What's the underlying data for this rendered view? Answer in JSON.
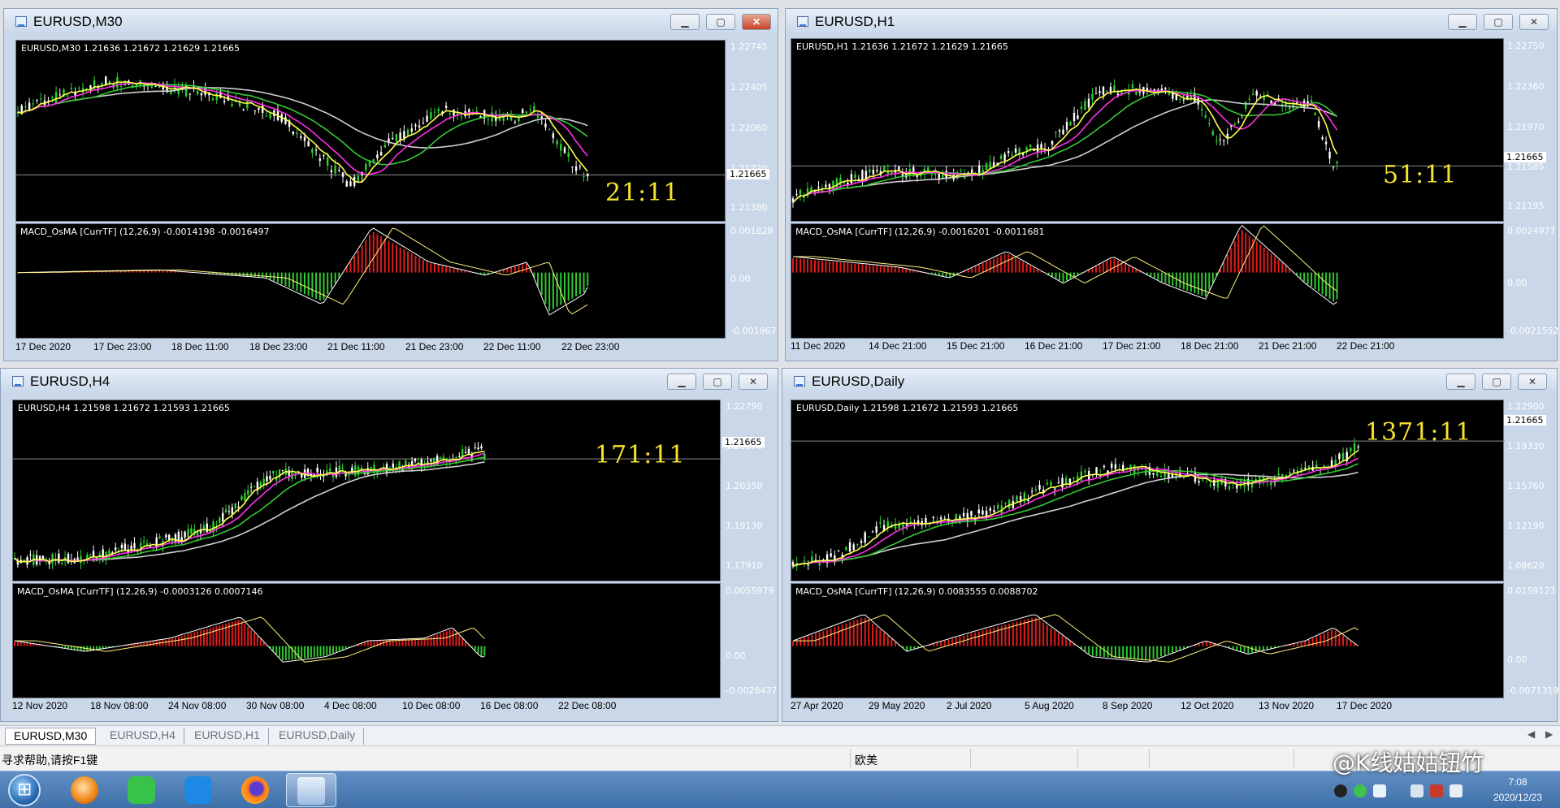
{
  "colors": {
    "bull_candle": "#2fd12f",
    "bear_candle": "#ffffff",
    "ma_yellow": "#ffff4d",
    "ma_magenta": "#ff2fe6",
    "ma_green": "#36c936",
    "ma_gray": "#cfcfcf",
    "macd_pos": "#e11c1c",
    "macd_neg": "#32c832",
    "timer": "#f5e22c"
  },
  "charts": [
    {
      "window_title": "EURUSD,M30",
      "main_header": "EURUSD,M30  1.21636 1.21672 1.21629 1.21665",
      "price_ticks": [
        "1.22745",
        "1.22405",
        "1.22060",
        "1.21720",
        "1.21380"
      ],
      "current_price_label": "1.21665",
      "timer": "21:11",
      "indicator_header": "MACD_OsMA [CurrTF] (12,26,9) -0.0014198 -0.0016497",
      "ind_ticks": [
        "0.001828",
        "0.00",
        "-0.001967"
      ],
      "date_ticks": [
        "17 Dec 2020",
        "17 Dec 23:00",
        "18 Dec 11:00",
        "18 Dec 23:00",
        "21 Dec 11:00",
        "21 Dec 23:00",
        "22 Dec 11:00",
        "22 Dec 23:00"
      ]
    },
    {
      "window_title": "EURUSD,H1",
      "main_header": "EURUSD,H1  1.21636 1.21672 1.21629 1.21665",
      "price_ticks": [
        "1.22750",
        "1.22360",
        "1.21970",
        "1.21585",
        "1.21195"
      ],
      "current_price_label": "1.21665",
      "timer": "51:11",
      "indicator_header": "MACD_OsMA [CurrTF] (12,26,9) -0.0016201 -0.0011681",
      "ind_ticks": [
        "0.0024977",
        "0.00",
        "-0.0021552"
      ],
      "date_ticks": [
        "11 Dec 2020",
        "14 Dec 21:00",
        "15 Dec 21:00",
        "16 Dec 21:00",
        "17 Dec 21:00",
        "18 Dec 21:00",
        "21 Dec 21:00",
        "22 Dec 21:00"
      ]
    },
    {
      "window_title": "EURUSD,H4",
      "main_header": "EURUSD,H4  1.21598 1.21672 1.21593 1.21665",
      "price_ticks": [
        "1.22790",
        "1.21570",
        "1.20350",
        "1.19130",
        "1.17910"
      ],
      "current_price_label": "1.21665",
      "timer": "171:11",
      "indicator_header": "MACD_OsMA [CurrTF] (12,26,9) -0.0003126 0.0007146",
      "ind_ticks": [
        "0.0055979",
        "0.00",
        "-0.0028437"
      ],
      "date_ticks": [
        "12 Nov 2020",
        "18 Nov 08:00",
        "24 Nov 08:00",
        "30 Nov 08:00",
        "4 Dec 08:00",
        "10 Dec 08:00",
        "16 Dec 08:00",
        "22 Dec 08:00"
      ]
    },
    {
      "window_title": "EURUSD,Daily",
      "main_header": "EURUSD,Daily  1.21598 1.21672 1.21593 1.21665",
      "price_ticks": [
        "1.22900",
        "1.19330",
        "1.15760",
        "1.12190",
        "1.08620"
      ],
      "current_price_label": "1.21665",
      "timer": "1371:11",
      "indicator_header": "MACD_OsMA [CurrTF] (12,26,9) 0.0083555 0.0088702",
      "ind_ticks": [
        "0.0159123",
        "0.00",
        "-0.0071319"
      ],
      "date_ticks": [
        "27 Apr 2020",
        "29 May 2020",
        "2 Jul 2020",
        "5 Aug 2020",
        "8 Sep 2020",
        "12 Oct 2020",
        "13 Nov 2020",
        "17 Dec 2020"
      ]
    }
  ],
  "tabs": [
    "EURUSD,M30",
    "EURUSD,H4",
    "EURUSD,H1",
    "EURUSD,Daily"
  ],
  "status": {
    "help": "寻求帮助,请按F1键",
    "profile": "欧美"
  },
  "taskbar": {
    "apps": [
      "360-browser-icon",
      "wechat-icon",
      "note-icon",
      "firefox-icon",
      "metatrader-icon"
    ],
    "clock_time": "7:08",
    "clock_date": "2020/12/23"
  },
  "watermark": "@K线姑姑钮竹"
}
